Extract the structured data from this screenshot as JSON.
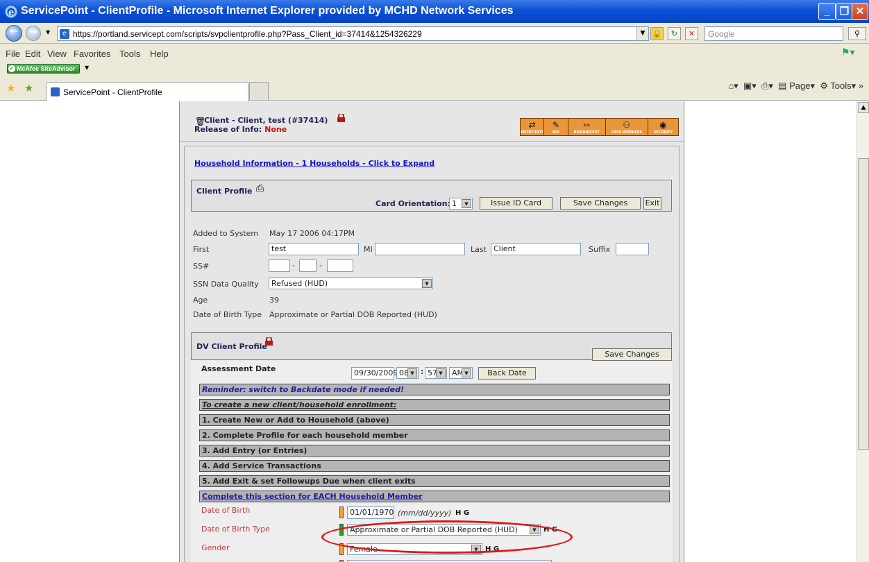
{
  "window": {
    "title": "ServicePoint - ClientProfile - Microsoft Internet Explorer provided by MCHD Network Services",
    "minimize": "_",
    "maximize": "❒",
    "close": "✕"
  },
  "address": {
    "url": "https://portland.servicept.com/scripts/svpclientprofile.php?Pass_Client_id=37414&1254326229",
    "search_placeholder": "Google"
  },
  "menu": [
    "File",
    "Edit",
    "View",
    "Favorites",
    "Tools",
    "Help"
  ],
  "toolbar_addon": {
    "mcafee_label": "McAfee SiteAdvisor"
  },
  "tabs": {
    "active_label": "ServicePoint - ClientProfile"
  },
  "command_bar": {
    "page": "Page",
    "tools": "Tools"
  },
  "client": {
    "header": "Client - Client, test (#37414)",
    "roi_label": "Release of Info:",
    "roi_value": "None",
    "toolbar_buttons": [
      {
        "label": "ENTRY/EXIT",
        "icon": "entry-exit-icon"
      },
      {
        "label": "ROI",
        "icon": "roi-icon"
      },
      {
        "label": "RESOURCEPT",
        "icon": "resource-icon"
      },
      {
        "label": "CASE WORKERS",
        "icon": "case-workers-icon"
      },
      {
        "label": "SECURITY",
        "icon": "security-icon"
      }
    ]
  },
  "household": {
    "link": "Household Information - 1 Households - Click to Expand"
  },
  "client_profile": {
    "title": "Client Profile",
    "card_orientation_label": "Card Orientation:",
    "card_orientation_value": "1",
    "issue_id_card": "Issue ID Card",
    "save_changes": "Save Changes",
    "exit": "Exit"
  },
  "profile_fields": {
    "added_label": "Added to System",
    "added_value": "May 17 2006 04:17PM",
    "first_label": "First",
    "first_value": "test",
    "mi_label": "MI",
    "mi_value": "",
    "last_label": "Last",
    "last_value": "Client",
    "suffix_label": "Suffix",
    "suffix_value": "",
    "ssn_label": "SS#",
    "ssn_dash": "-",
    "ssn_quality_label": "SSN Data Quality",
    "ssn_quality_value": "Refused (HUD)",
    "age_label": "Age",
    "age_value": "39",
    "dob_type_label": "Date of Birth Type",
    "dob_type_value": "Approximate or Partial DOB Reported (HUD)"
  },
  "dv_profile": {
    "title": "DV Client Profile",
    "save_changes": "Save Changes"
  },
  "assessment": {
    "label": "Assessment Date",
    "date": "09/30/2009",
    "hour": "08",
    "colon": ":",
    "minute": "57",
    "ampm": "AM",
    "back_date": "Back Date"
  },
  "instructions": [
    "Reminder: switch to Backdate mode if needed!",
    "To create a new client/household enrollment:",
    "1. Create New or Add to Household (above)",
    "2. Complete Profile for each household member",
    "3. Add Entry (or Entries)",
    "4. Add Service Transactions",
    "5. Add Exit & set Followups Due when client exits",
    "Complete this section for EACH Household Member"
  ],
  "member_fields": {
    "dob_label": "Date of Birth",
    "dob_value": "01/01/1970",
    "dob_hint": "(mm/dd/yyyy)",
    "dob_type_label": "Date of Birth Type",
    "dob_type_value": "Approximate or Partial DOB Reported (HUD)",
    "gender_label": "Gender",
    "gender_value": "Female",
    "hg": "H G"
  },
  "colors": {
    "titlebar": "#0a50d6",
    "link": "#1414c8",
    "required_orange": "#f0a03a",
    "required_green": "#2a9a2a",
    "annotation": "#e01616",
    "toolbar_orange": "#e9963a"
  }
}
